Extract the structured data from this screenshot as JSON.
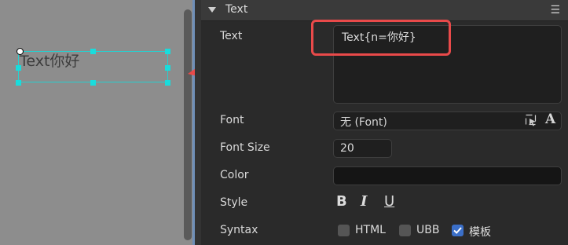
{
  "canvas": {
    "selected_text": "Text你好"
  },
  "panel": {
    "section_title": "Text",
    "menu_icon": "hamburger-menu-icon",
    "text_label": "Text",
    "text_value": "Text{n=你好}",
    "font_label": "Font",
    "font_value": "无 (Font)",
    "font_size_label": "Font Size",
    "font_size_value": "20",
    "color_label": "Color",
    "color_value": "#151515",
    "style_label": "Style",
    "style_bold": "B",
    "style_italic": "I",
    "style_underline": "U",
    "syntax_label": "Syntax",
    "syntax_options": [
      {
        "label": "HTML",
        "checked": false
      },
      {
        "label": "UBB",
        "checked": false
      },
      {
        "label": "模板",
        "checked": true
      }
    ]
  },
  "colors": {
    "arrow": "#e94a4a",
    "selection": "#19dcdc",
    "accent": "#3b6fc8"
  }
}
